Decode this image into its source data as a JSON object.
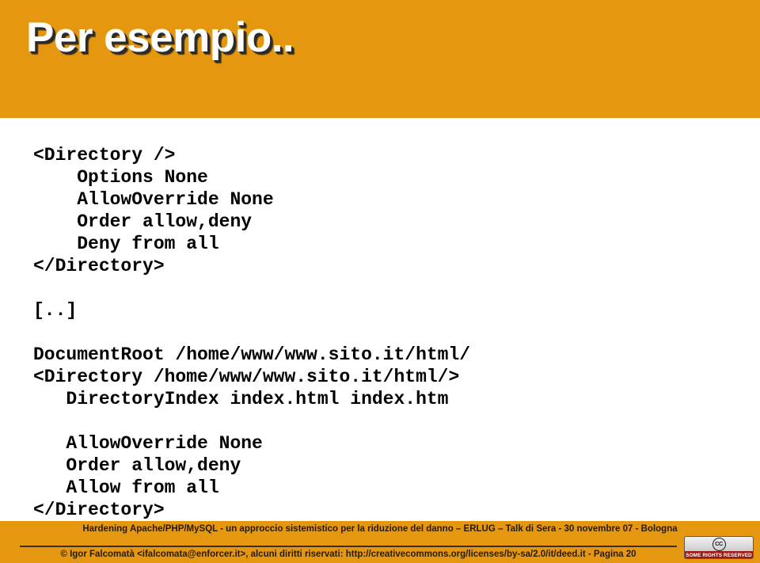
{
  "slide": {
    "title": "Per esempio..",
    "page_number": "20",
    "header_color": "#e59710",
    "title_color": "#ffffff",
    "body_background": "#ffffff",
    "code_color": "#000000",
    "footer_text_color": "#231b10"
  },
  "code_lines": [
    "<Directory />",
    "    Options None",
    "    AllowOverride None",
    "    Order allow,deny",
    "    Deny from all",
    "</Directory>",
    "",
    "[..]",
    "",
    "DocumentRoot /home/www/www.sito.it/html/",
    "<Directory /home/www/www.sito.it/html/>",
    "   DirectoryIndex index.html index.htm",
    "",
    "   AllowOverride None",
    "   Order allow,deny",
    "   Allow from all",
    "</Directory>"
  ],
  "footer": {
    "line1": "Hardening Apache/PHP/MySQL - un approccio sistemistico per la riduzione del danno – ERLUG – Talk di Sera - 30 novembre 07 - Bologna",
    "line2": "© Igor Falcomatà <ifalcomata@enforcer.it>, alcuni diritti riservati: http://creativecommons.org/licenses/by-sa/2.0/it/deed.it  - Pagina 20",
    "license_badge": {
      "mark": "CC",
      "label": "SOME RIGHTS RESERVED",
      "strip_color": "#9c1a13"
    }
  }
}
